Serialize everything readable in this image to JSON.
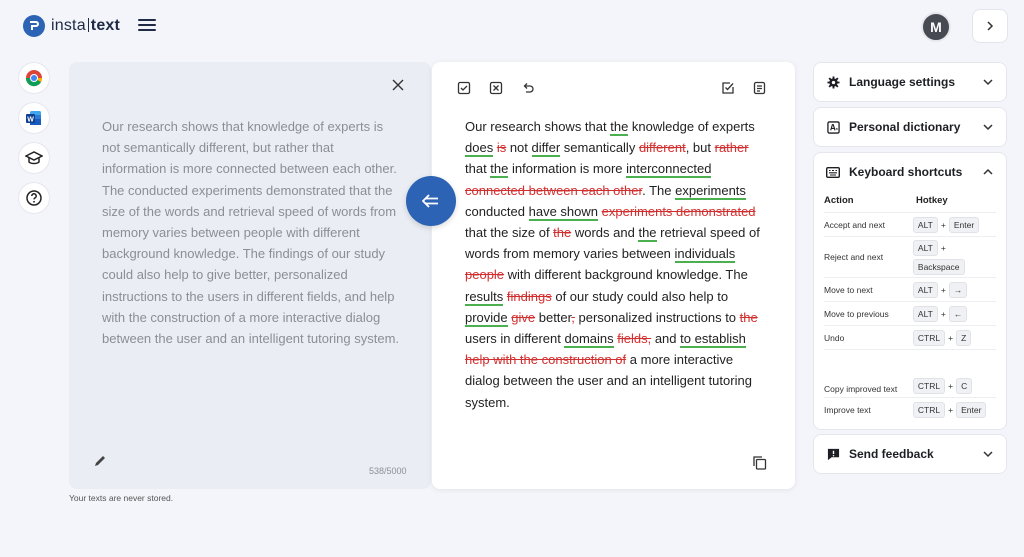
{
  "brand": {
    "part1": "insta",
    "part2": "text"
  },
  "privacy_note": "Your texts are never stored.",
  "user": {
    "initial": "M"
  },
  "input": {
    "text": "Our research shows that knowledge of experts is not semantically different, but rather that information is more connected between each other. The conducted experiments demonstrated that the size of the words and retrieval speed of words from memory varies between people with different background knowledge. The findings of our study could also help to give better, personalized instructions to the users in different fields, and help with the construction of a more interactive dialog between the user and an intelligent tutoring system.",
    "counter": "538/5000"
  },
  "output": {
    "segments": [
      {
        "t": "Our research shows that ",
        "k": "n"
      },
      {
        "t": "the",
        "k": "i"
      },
      {
        "t": " knowledge of experts ",
        "k": "n"
      },
      {
        "t": "does",
        "k": "i"
      },
      {
        "t": " ",
        "k": "n"
      },
      {
        "t": "is",
        "k": "d"
      },
      {
        "t": " not ",
        "k": "n"
      },
      {
        "t": "differ",
        "k": "i"
      },
      {
        "t": " semantically ",
        "k": "n"
      },
      {
        "t": "different",
        "k": "d"
      },
      {
        "t": ", but ",
        "k": "n"
      },
      {
        "t": "rather",
        "k": "d"
      },
      {
        "t": " that ",
        "k": "n"
      },
      {
        "t": "the",
        "k": "i"
      },
      {
        "t": " information is more ",
        "k": "n"
      },
      {
        "t": "interconnected",
        "k": "i"
      },
      {
        "t": " ",
        "k": "n"
      },
      {
        "t": "connected between each other",
        "k": "d"
      },
      {
        "t": ". The ",
        "k": "n"
      },
      {
        "t": "experiments",
        "k": "i"
      },
      {
        "t": " conducted ",
        "k": "n"
      },
      {
        "t": "have shown",
        "k": "i"
      },
      {
        "t": " ",
        "k": "n"
      },
      {
        "t": "experiments demonstrated",
        "k": "d"
      },
      {
        "t": " that the size of ",
        "k": "n"
      },
      {
        "t": "the",
        "k": "d"
      },
      {
        "t": " words and ",
        "k": "n"
      },
      {
        "t": "the",
        "k": "i"
      },
      {
        "t": " retrieval speed of words from memory varies between ",
        "k": "n"
      },
      {
        "t": "individuals",
        "k": "i"
      },
      {
        "t": " ",
        "k": "n"
      },
      {
        "t": "people",
        "k": "d"
      },
      {
        "t": " with different background knowledge. The ",
        "k": "n"
      },
      {
        "t": "results",
        "k": "i"
      },
      {
        "t": " ",
        "k": "n"
      },
      {
        "t": "findings",
        "k": "d"
      },
      {
        "t": " of our study could also help to ",
        "k": "n"
      },
      {
        "t": "provide",
        "k": "i"
      },
      {
        "t": " ",
        "k": "n"
      },
      {
        "t": "give",
        "k": "d"
      },
      {
        "t": " better",
        "k": "n"
      },
      {
        "t": ",",
        "k": "d"
      },
      {
        "t": " personalized instructions to ",
        "k": "n"
      },
      {
        "t": "the",
        "k": "d"
      },
      {
        "t": " users in different ",
        "k": "n"
      },
      {
        "t": "domains",
        "k": "i"
      },
      {
        "t": " ",
        "k": "n"
      },
      {
        "t": "fields,",
        "k": "d"
      },
      {
        "t": " and ",
        "k": "n"
      },
      {
        "t": "to establish",
        "k": "i"
      },
      {
        "t": " ",
        "k": "n"
      },
      {
        "t": "help with the construction of",
        "k": "d"
      },
      {
        "t": " a more interactive dialog between the user and an intelligent tutoring system.",
        "k": "n"
      }
    ]
  },
  "sidebar": {
    "language_settings": "Language settings",
    "personal_dictionary": "Personal dictionary",
    "keyboard_shortcuts": "Keyboard shortcuts",
    "send_feedback": "Send feedback",
    "kb_headers": {
      "action": "Action",
      "hotkey": "Hotkey"
    },
    "shortcuts": [
      {
        "action": "Accept and next",
        "keys": [
          "ALT",
          "Enter"
        ]
      },
      {
        "action": "Reject and next",
        "keys": [
          "ALT",
          "Backspace"
        ]
      },
      {
        "action": "Move to next",
        "keys": [
          "ALT",
          "→"
        ]
      },
      {
        "action": "Move to previous",
        "keys": [
          "ALT",
          "←"
        ]
      },
      {
        "action": "Undo",
        "keys": [
          "CTRL",
          "Z"
        ]
      },
      {
        "action": "Copy improved text",
        "keys": [
          "CTRL",
          "C"
        ]
      },
      {
        "action": "Improve text",
        "keys": [
          "CTRL",
          "Enter"
        ]
      }
    ]
  },
  "colors": {
    "accent": "#2c63b5",
    "insert": "#4caf50",
    "delete": "#d32f2f"
  }
}
